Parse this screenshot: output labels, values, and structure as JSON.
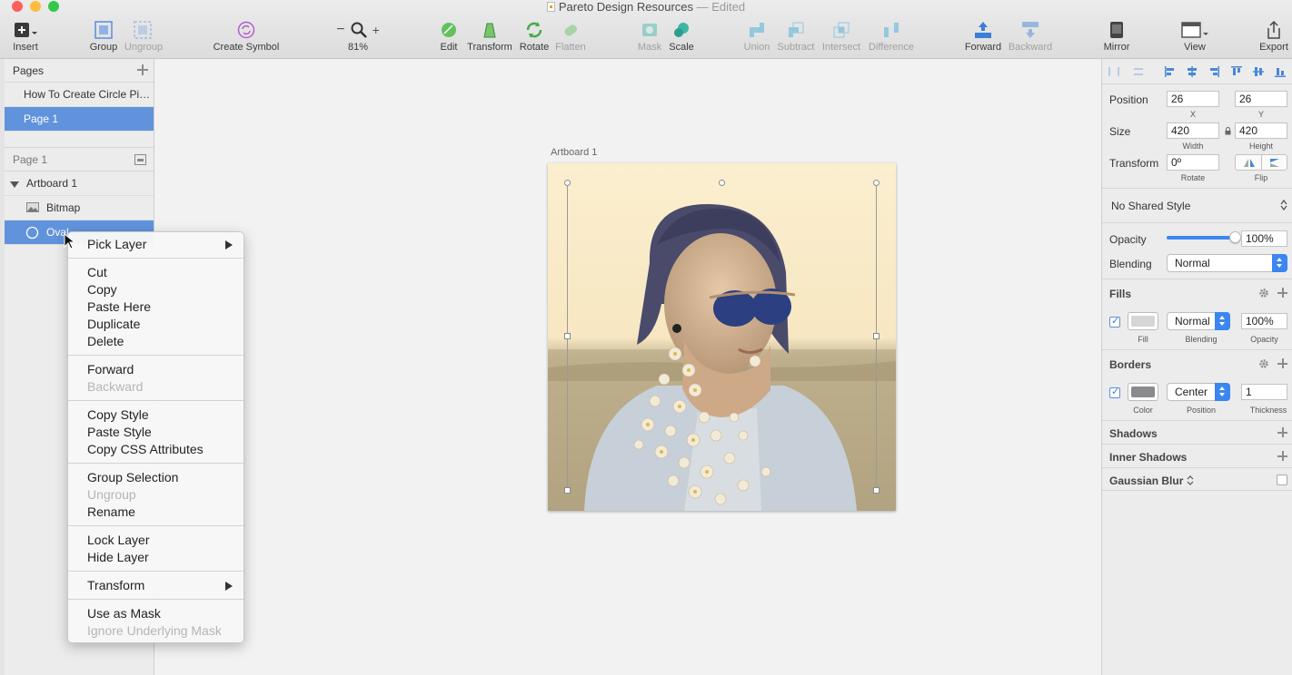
{
  "window": {
    "title": "Pareto Design Resources",
    "status": "— Edited",
    "colors": {
      "close": "#fc605c",
      "minimize": "#fdbc40",
      "zoom": "#34c84a"
    }
  },
  "toolbar": {
    "insert": "Insert",
    "group": "Group",
    "ungroup": "Ungroup",
    "create_symbol": "Create Symbol",
    "zoom_level": "81%",
    "edit": "Edit",
    "transform": "Transform",
    "rotate": "Rotate",
    "flatten": "Flatten",
    "mask": "Mask",
    "scale": "Scale",
    "union": "Union",
    "subtract": "Subtract",
    "intersect": "Intersect",
    "difference": "Difference",
    "forward": "Forward",
    "backward": "Backward",
    "mirror": "Mirror",
    "view": "View",
    "export": "Export"
  },
  "pages_panel": {
    "header": "Pages",
    "pages": [
      {
        "label": "How To Create Circle Pic..."
      },
      {
        "label": "Page 1"
      }
    ]
  },
  "layers_panel": {
    "header": "Page 1",
    "artboard": "Artboard 1",
    "layers": [
      {
        "label": "Bitmap"
      },
      {
        "label": "Oval"
      }
    ]
  },
  "canvas": {
    "artboard_label": "Artboard 1"
  },
  "context_menu": {
    "pick_layer": "Pick Layer",
    "cut": "Cut",
    "copy": "Copy",
    "paste_here": "Paste Here",
    "duplicate": "Duplicate",
    "delete": "Delete",
    "forward": "Forward",
    "backward": "Backward",
    "copy_style": "Copy Style",
    "paste_style": "Paste Style",
    "copy_css": "Copy CSS Attributes",
    "group_selection": "Group Selection",
    "ungroup": "Ungroup",
    "rename": "Rename",
    "lock_layer": "Lock Layer",
    "hide_layer": "Hide Layer",
    "transform": "Transform",
    "use_as_mask": "Use as Mask",
    "ignore_mask": "Ignore Underlying Mask"
  },
  "inspector": {
    "position_label": "Position",
    "x_value": "26",
    "y_value": "26",
    "x_label": "X",
    "y_label": "Y",
    "size_label": "Size",
    "width_value": "420",
    "height_value": "420",
    "width_label": "Width",
    "height_label": "Height",
    "transform_label": "Transform",
    "rotate_value": "0º",
    "rotate_label": "Rotate",
    "flip_label": "Flip",
    "shared_style": "No Shared Style",
    "opacity_label": "Opacity",
    "opacity_value": "100%",
    "opacity_level": 1.0,
    "blending_label": "Blending",
    "blending_value": "Normal",
    "fills": {
      "title": "Fills",
      "blending_value": "Normal",
      "opacity_value": "100%",
      "fill_label": "Fill",
      "blending_label": "Blending",
      "opacity_label": "Opacity",
      "color": "#d6d6d6"
    },
    "borders": {
      "title": "Borders",
      "position_value": "Center",
      "thickness_value": "1",
      "color_label": "Color",
      "position_label": "Position",
      "thickness_label": "Thickness",
      "color": "#8a8a8e"
    },
    "shadows": "Shadows",
    "inner_shadows": "Inner Shadows",
    "gaussian_blur": "Gaussian Blur"
  }
}
